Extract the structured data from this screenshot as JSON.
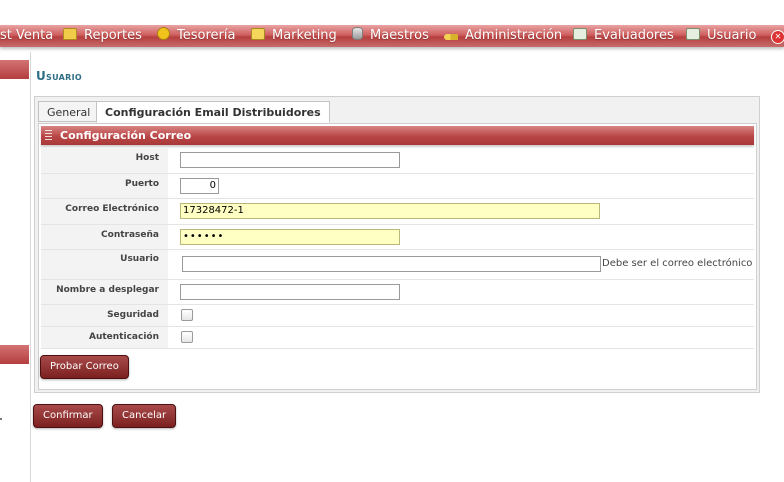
{
  "menu": [
    {
      "label": "st Venta",
      "icon": "none"
    },
    {
      "label": "Reportes",
      "icon": "folder-icon"
    },
    {
      "label": "Tesorería",
      "icon": "coin-icon"
    },
    {
      "label": "Marketing",
      "icon": "message-icon"
    },
    {
      "label": "Maestros",
      "icon": "database-icon"
    },
    {
      "label": "Administración",
      "icon": "key-icon"
    },
    {
      "label": "Evaluadores",
      "icon": "app-icon"
    },
    {
      "label": "Usuario",
      "icon": "app-icon"
    }
  ],
  "page": {
    "title": "Usuario"
  },
  "tabs": [
    {
      "label": "General",
      "active": false
    },
    {
      "label": "Configuración Email Distribuidores",
      "active": true
    }
  ],
  "section": {
    "title": "Configuración Correo"
  },
  "form": {
    "host": {
      "label": "Host",
      "value": ""
    },
    "puerto": {
      "label": "Puerto",
      "value": "0"
    },
    "correo": {
      "label": "Correo Electrónico",
      "value": "17328472-1"
    },
    "password": {
      "label": "Contraseña",
      "value": "••••••"
    },
    "usuario": {
      "label": "Usuario",
      "value": "",
      "hint": "Debe ser el correo electrónico"
    },
    "nombre": {
      "label": "Nombre a desplegar",
      "value": ""
    },
    "seguridad": {
      "label": "Seguridad",
      "checked": false
    },
    "autenticacion": {
      "label": "Autenticación",
      "checked": false
    }
  },
  "buttons": {
    "test": "Probar Correo",
    "confirm": "Confirmar",
    "cancel": "Cancelar"
  },
  "colors": {
    "accent": "#b94646",
    "title": "#2d6e84",
    "highlight_field": "#ffffc4"
  }
}
